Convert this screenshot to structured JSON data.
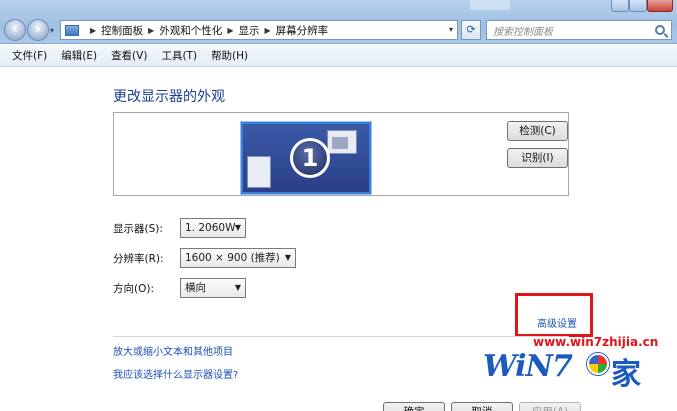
{
  "breadcrumb": [
    "控制面板",
    "外观和个性化",
    "显示",
    "屏幕分辨率"
  ],
  "search": {
    "placeholder": "搜索控制面板"
  },
  "menu": [
    "文件(F)",
    "编辑(E)",
    "查看(V)",
    "工具(T)",
    "帮助(H)"
  ],
  "heading": "更改显示器的外观",
  "monitor": {
    "number": "1"
  },
  "buttons": {
    "detect": "检测(C)",
    "identify": "识别(I)"
  },
  "fields": {
    "display": {
      "label": "显示器(S):",
      "value": "1. 2060W"
    },
    "resolution": {
      "label": "分辨率(R):",
      "value": "1600 × 900 (推荐)"
    },
    "orientation": {
      "label": "方向(O):",
      "value": "横向"
    }
  },
  "advanced_link": "高级设置",
  "links": [
    "放大或缩小文本和其他项目",
    "我应该选择什么显示器设置?"
  ],
  "footer_buttons": {
    "ok": "确定",
    "cancel": "取消",
    "apply": "应用(A)"
  },
  "watermark": {
    "url": "www.win7zhijia.cn",
    "brand": "WiN7",
    "char": "家"
  },
  "colors": {
    "highlight_box": "#e0151c",
    "link": "#1c50b8",
    "heading": "#1c3f95"
  }
}
